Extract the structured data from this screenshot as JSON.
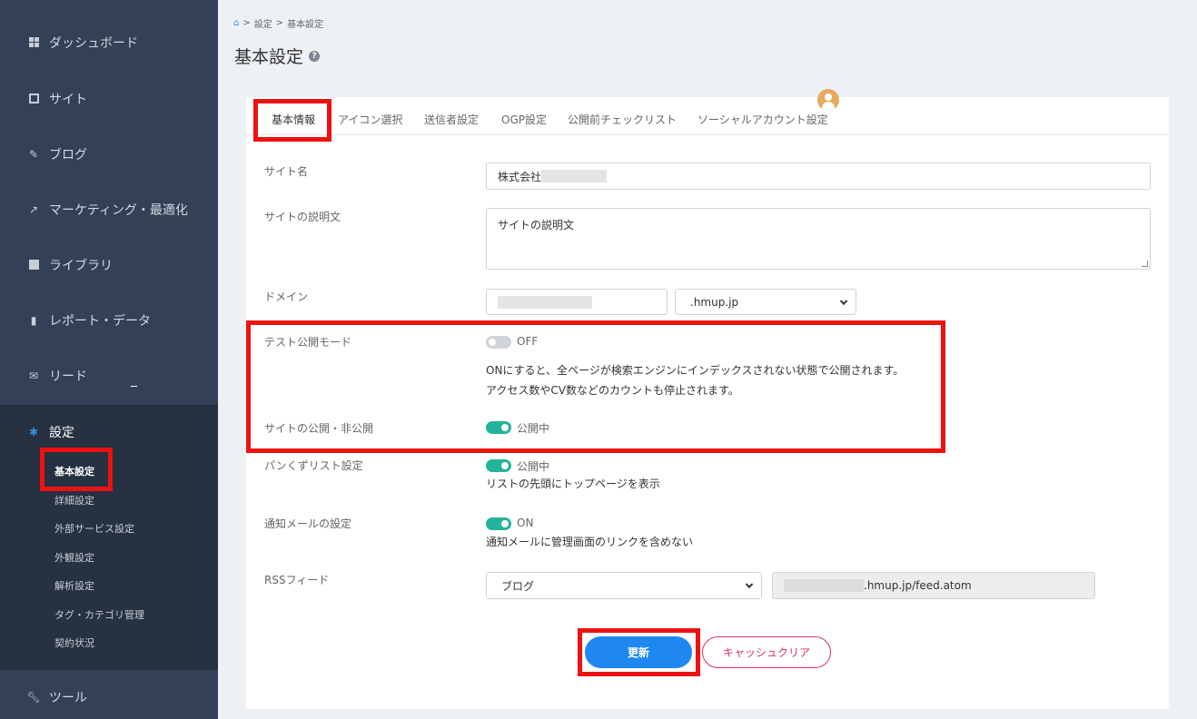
{
  "sidebar": {
    "items": [
      {
        "label": "ダッシュボード",
        "icon": "dashboard-icon"
      },
      {
        "label": "サイト",
        "icon": "site-icon"
      },
      {
        "label": "ブログ",
        "icon": "pencil-icon"
      },
      {
        "label": "マーケティング・最適化",
        "icon": "trend-icon"
      },
      {
        "label": "ライブラリ",
        "icon": "image-icon"
      },
      {
        "label": "レポート・データ",
        "icon": "bar-chart-icon"
      },
      {
        "label": "リード",
        "icon": "mail-icon"
      },
      {
        "label": "設定",
        "icon": "gear-icon"
      },
      {
        "label": "ツール",
        "icon": "wrench-icon"
      }
    ],
    "settings_sub": [
      "基本設定",
      "詳細設定",
      "外部サービス設定",
      "外観設定",
      "解析設定",
      "タグ・カテゴリ管理",
      "契約状況"
    ]
  },
  "breadcrumb": {
    "sep": ">",
    "items": [
      "設定",
      "基本設定"
    ]
  },
  "page_title": "基本設定",
  "tabs": [
    "基本情報",
    "アイコン選択",
    "送信者設定",
    "OGP設定",
    "公開前チェックリスト",
    "ソーシャルアカウント設定"
  ],
  "form": {
    "site_name": {
      "label": "サイト名",
      "value": "株式会社"
    },
    "site_desc": {
      "label": "サイトの説明文",
      "value": "サイトの説明文"
    },
    "domain": {
      "label": "ドメイン",
      "suffix": ".hmup.jp"
    },
    "test_mode": {
      "label": "テスト公開モード",
      "state": "OFF",
      "desc1": "ONにすると、全ページが検索エンジンにインデックスされない状態で公開されます。",
      "desc2": "アクセス数やCV数などのカウントも停止されます。"
    },
    "publish": {
      "label": "サイトの公開・非公開",
      "state": "公開中"
    },
    "breadcrumb_setting": {
      "label": "パンくずリスト設定",
      "state": "公開中",
      "desc": "リストの先頭にトップページを表示"
    },
    "notify": {
      "label": "通知メールの設定",
      "state": "ON",
      "desc": "通知メールに管理画面のリンクを含めない"
    },
    "rss": {
      "label": "RSSフィード",
      "select": "ブログ",
      "url_suffix": ".hmup.jp/feed.atom"
    }
  },
  "buttons": {
    "update": "更新",
    "cache": "キャッシュクリア"
  },
  "colors": {
    "sidebar": "#334055",
    "toggle_on": "#22b59a",
    "primary": "#1e88f0",
    "danger": "#d9335c",
    "highlight": "#ee1111"
  }
}
